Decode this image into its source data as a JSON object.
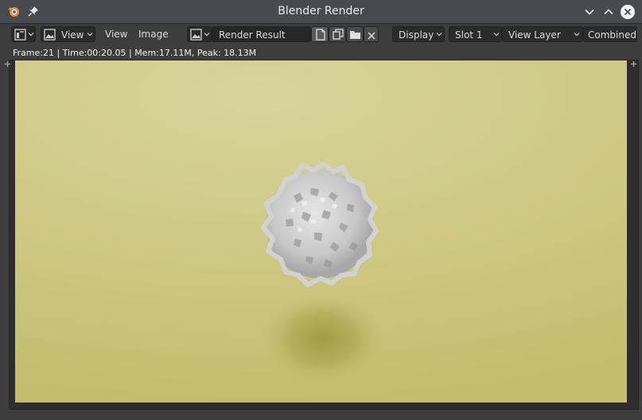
{
  "window": {
    "title": "Blender Render",
    "app_icon": "blender-logo-icon",
    "pin_icon": "pin-icon",
    "controls": [
      "minimize-icon",
      "maximize-icon",
      "close-icon"
    ]
  },
  "toolbar": {
    "editor_type_icon": "image-editor-icon",
    "mode_icon": "image-icon",
    "mode_label": "View",
    "menu_view": "View",
    "menu_image": "Image",
    "image_browse_icon": "image-browse-icon",
    "image_name": "Render Result",
    "new_icon": "new-image-icon",
    "duplicate_icon": "duplicate-icon",
    "open_icon": "folder-icon",
    "unlink_icon": "x-icon",
    "display_label": "Display",
    "slot_label": "Slot 1",
    "view_layer_label": "View Layer",
    "pass_label": "Combined"
  },
  "status": {
    "text": "Frame:21 | Time:00:20.05 | Mem:17.11M, Peak: 18.13M"
  },
  "render": {
    "background_color": "#cfca86",
    "object_color": "#d6d6d6",
    "shadow_color": "#a39d4a"
  }
}
